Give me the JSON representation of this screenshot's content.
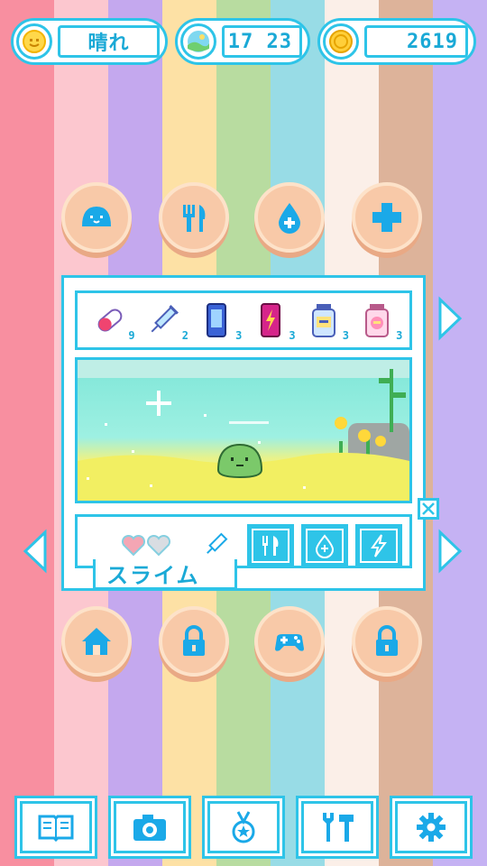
{
  "status": {
    "weather": "晴れ",
    "time": "17 23",
    "coins": "2619"
  },
  "colors": {
    "accent": "#2ec4e8",
    "button": "#f8c9a8",
    "stripes": [
      "#f88fa0",
      "#fcc7cf",
      "#c4a8ee",
      "#fde1a5",
      "#b8dca0",
      "#98dce6",
      "#fbefe8",
      "#ddb39a",
      "#c5b2f3"
    ]
  },
  "top_buttons": [
    {
      "icon": "slime-face-icon"
    },
    {
      "icon": "fork-knife-icon"
    },
    {
      "icon": "water-drop-icon"
    },
    {
      "icon": "plus-icon"
    }
  ],
  "items": [
    {
      "icon": "capsule-icon",
      "count": "9"
    },
    {
      "icon": "syringe-icon",
      "count": "2"
    },
    {
      "icon": "blue-can-icon",
      "count": "3"
    },
    {
      "icon": "energy-drink-icon",
      "count": "3"
    },
    {
      "icon": "blue-jar-icon",
      "count": "3"
    },
    {
      "icon": "pink-jar-icon",
      "count": "3"
    }
  ],
  "pet": {
    "name": "スライム",
    "hearts": 1.5
  },
  "actions": [
    {
      "icon": "fork-knife-icon"
    },
    {
      "icon": "water-drop-icon"
    },
    {
      "icon": "lightning-icon"
    }
  ],
  "bottom_buttons": [
    {
      "icon": "house-icon"
    },
    {
      "icon": "lock-icon"
    },
    {
      "icon": "gamepad-icon"
    },
    {
      "icon": "lock-icon"
    }
  ],
  "nav": [
    {
      "icon": "book-icon"
    },
    {
      "icon": "camera-icon"
    },
    {
      "icon": "medal-icon"
    },
    {
      "icon": "tools-icon"
    },
    {
      "icon": "gear-icon"
    }
  ]
}
